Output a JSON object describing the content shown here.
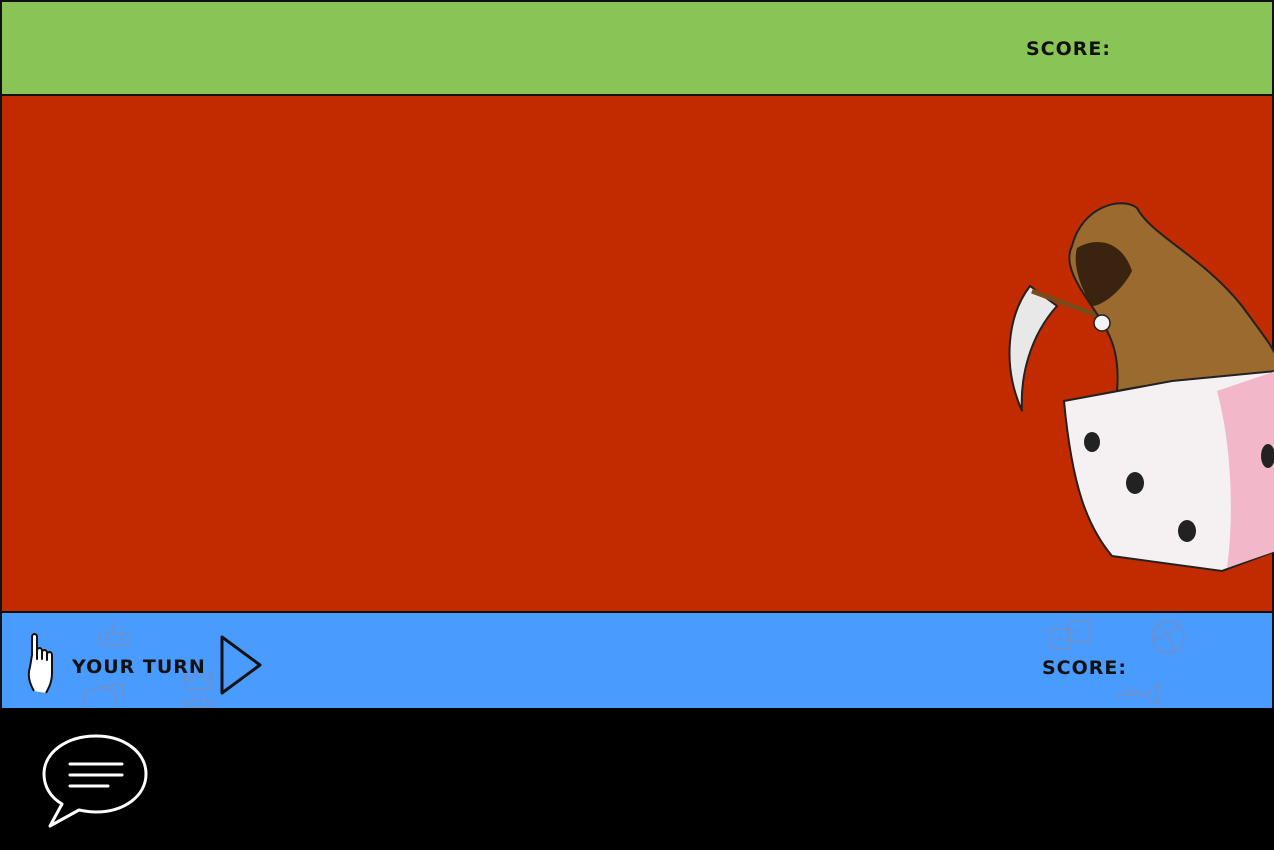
{
  "top_player": {
    "score_label": "SCORE:"
  },
  "bottom_player": {
    "score_label": "SCORE:",
    "turn_label": "YOUR TURN"
  },
  "icons": {
    "hand": "pointing-hand-icon",
    "play": "play-icon",
    "chat": "chat-bubble-icon",
    "mascot": "reaper-on-dice-icon"
  },
  "colors": {
    "top_bar": "#88c556",
    "board": "#c22a00",
    "bottom_bar": "#4a9bfe",
    "footer": "#000000"
  }
}
